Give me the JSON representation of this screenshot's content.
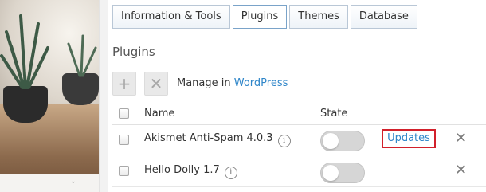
{
  "tabs": [
    {
      "label": "Information & Tools"
    },
    {
      "label": "Plugins"
    },
    {
      "label": "Themes"
    },
    {
      "label": "Database"
    }
  ],
  "active_tab": "Plugins",
  "section_title": "Plugins",
  "toolbar": {
    "add_icon": "plus-icon",
    "remove_icon": "x-icon",
    "manage_text": "Manage in ",
    "manage_link": "WordPress"
  },
  "table": {
    "headers": {
      "name": "Name",
      "state": "State"
    },
    "rows": [
      {
        "name": "Akismet Anti-Spam 4.0.3",
        "state": "off",
        "action": "Updates"
      },
      {
        "name": "Hello Dolly 1.7",
        "state": "off",
        "action": ""
      }
    ]
  },
  "colors": {
    "link": "#2f86c9",
    "highlight_border": "#d2202b",
    "toggle_off": "#d6d6d6"
  }
}
